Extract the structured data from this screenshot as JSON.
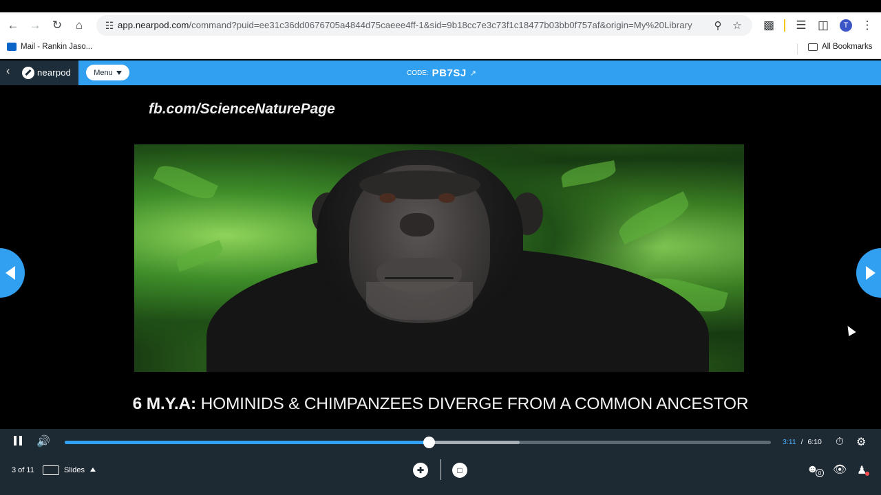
{
  "browser": {
    "url_host": "app.nearpod.com",
    "url_path": "/command?puid=ee31c36dd0676705a4844d75caeee4ff-1&sid=9b18cc7e3c73f1c18477b03bb0f757af&origin=My%20Library",
    "profile_initial": "T"
  },
  "bookmarks": {
    "mail_label": "Mail - Rankin Jaso...",
    "all_bookmarks_label": "All Bookmarks"
  },
  "nearpod": {
    "brand": "nearpod",
    "menu_label": "Menu",
    "code_label": "CODE:",
    "code_value": "PB7SJ"
  },
  "slide": {
    "watermark": "fb.com/ScienceNaturePage",
    "caption_bold": "6 M.Y.A:",
    "caption_rest": " HOMINIDS & CHIMPANZEES DIVERGE FROM A COMMON ANCESTOR"
  },
  "player": {
    "current_time": "3:11",
    "separator": "/",
    "duration": "6:10",
    "progress_fraction": 0.516,
    "buffered_fraction": 0.644
  },
  "footer": {
    "slide_counter": "3 of 11",
    "slides_label": "Slides",
    "participants_count": "0"
  },
  "colors": {
    "accent": "#31a0f1",
    "header_dark": "#1d2d3a",
    "player_bg": "#1e2a33"
  }
}
